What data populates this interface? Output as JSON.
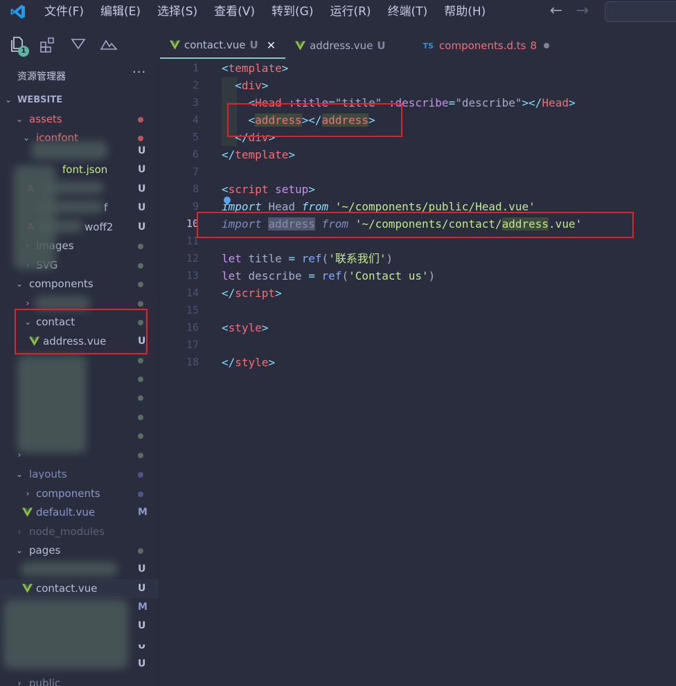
{
  "menu": [
    "文件(F)",
    "编辑(E)",
    "选择(S)",
    "查看(V)",
    "转到(G)",
    "运行(R)",
    "终端(T)",
    "帮助(H)"
  ],
  "nav": {
    "back": "←",
    "forward": "→"
  },
  "activity": {
    "badge": "1"
  },
  "explorer": {
    "title": "资源管理器",
    "more": "···",
    "root": "WEBSITE"
  },
  "tree": {
    "assets": "assets",
    "iconfont": "iconfont",
    "iconfont_json": "font.json",
    "woff_a": "f",
    "woff2": "woff2",
    "images": "images",
    "svg": "SVG",
    "components": "components",
    "contact": "contact",
    "address_vue": "address.vue",
    "layouts": "layouts",
    "layouts_components": "components",
    "default_vue": "default.vue",
    "node_modules": "node_modules",
    "pages": "pages",
    "contact_vue": "contact.vue",
    "public": "public",
    "status_u": "U",
    "status_m": "M"
  },
  "tabs": [
    {
      "label": "contact.vue",
      "mod": "U",
      "close": "✕"
    },
    {
      "label": "address.vue",
      "mod": "U"
    },
    {
      "icon": "TS",
      "label": "components.d.ts",
      "mod": "8"
    }
  ],
  "line_numbers": [
    "1",
    "2",
    "3",
    "4",
    "5",
    "6",
    "7",
    "8",
    "9",
    "10",
    "11",
    "12",
    "13",
    "14",
    "15",
    "16",
    "17",
    "18"
  ],
  "code": {
    "template_open": "template",
    "div": "div",
    "head_tag": "Head",
    "title_attr": ":title",
    "title_val": "\"title\"",
    "describe_attr": ":describe",
    "describe_val": "\"describe\"",
    "address_tag": "address",
    "script_tag": "script",
    "setup": "setup",
    "import_kw": "import",
    "head_id": "Head",
    "from_kw": "from",
    "head_path": "'~/components/public/Head.vue'",
    "address_id": "address",
    "address_path_a": "'~/components/contact/",
    "address_path_b": "address",
    "address_path_c": ".vue'",
    "let_kw": "let",
    "title_id": "title",
    "eq": "=",
    "ref_fn": "ref",
    "title_str": "'联系我们'",
    "describe_id": "describe",
    "describe_str": "'Contact us'",
    "style_tag": "style"
  }
}
